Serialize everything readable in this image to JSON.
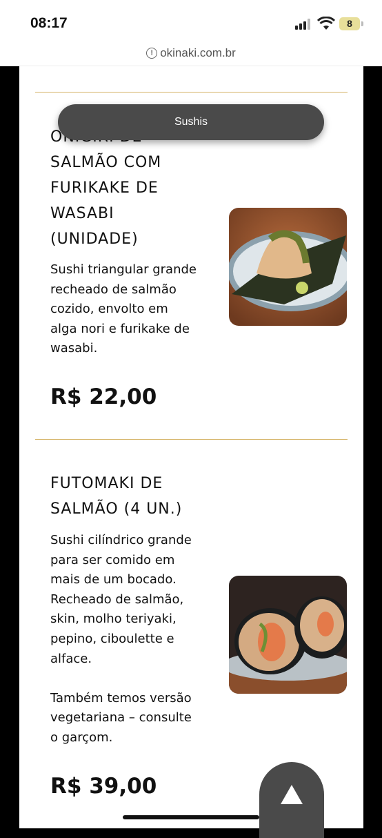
{
  "status": {
    "time": "08:17",
    "battery": "8"
  },
  "browser": {
    "url": "okinaki.com.br"
  },
  "category_pill": "Sushis",
  "items": [
    {
      "title": "ONIGIRI DE\nSALMÃO COM\nFURIKAKE DE\nWASABI\n(UNIDADE)",
      "description": "Sushi triangular grande\nrecheado de salmão\ncozido, envolto em\nalga nori e furikake de\nwasabi.",
      "price": "R$ 22,00"
    },
    {
      "title": "FUTOMAKI DE\nSALMÃO (4 UN.)",
      "description": "Sushi cilíndrico grande\npara ser comido em\nmais de um bocado.\nRecheado de salmão,\nskin, molho teriyaki,\npepino, ciboulette e\nalface.\n\nTambém temos versão\nvegetariana – consulte\no garçom.",
      "price": "R$ 39,00"
    }
  ]
}
